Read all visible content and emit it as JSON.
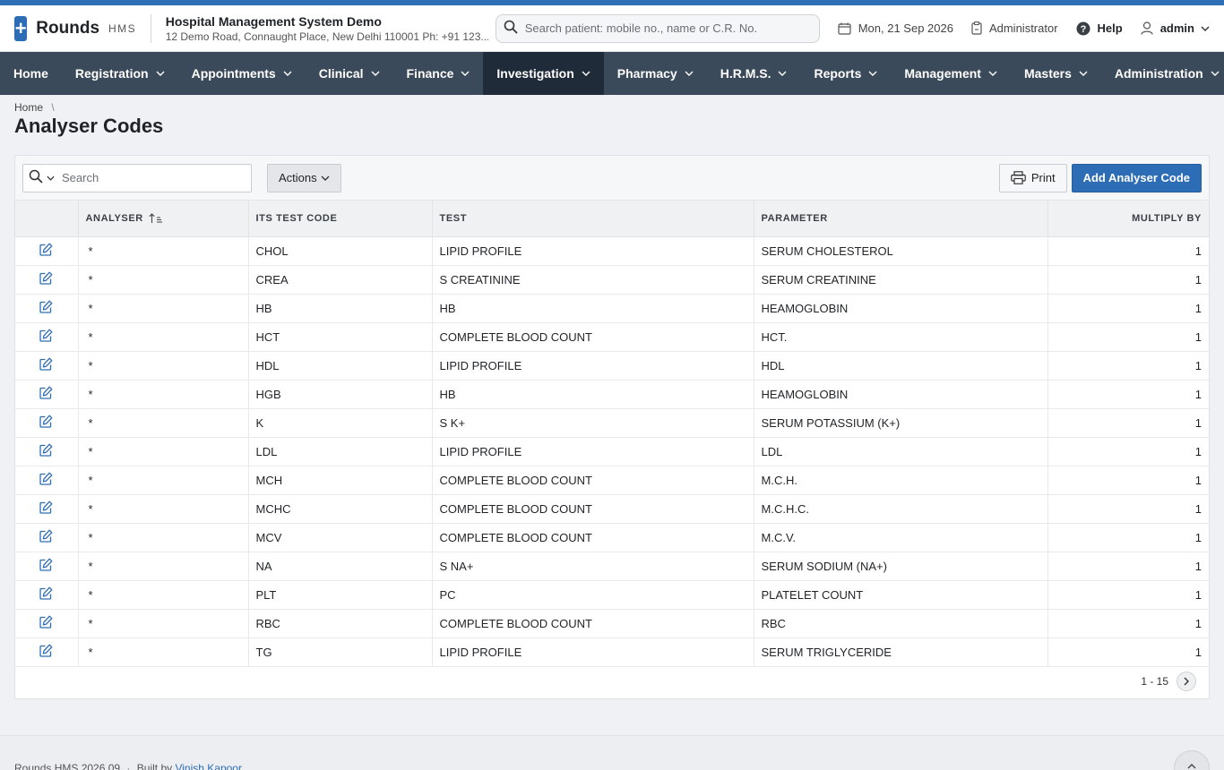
{
  "app": {
    "brand": "Rounds",
    "brand_sub": "HMS",
    "logo_icon": "plus-icon",
    "accent": "#2d6db5",
    "nav_bg": "#3b4a5a"
  },
  "header": {
    "org_name": "Hospital Management System Demo",
    "org_address": "12 Demo Road, Connaught Place, New Delhi 110001 Ph: +91 123...",
    "search_placeholder": "Search patient: mobile no., name or C.R. No.",
    "date": "Mon, 21 Sep 2026",
    "role": "Administrator",
    "help": "Help",
    "user": "admin"
  },
  "nav": {
    "items": [
      {
        "label": "Home"
      },
      {
        "label": "Registration"
      },
      {
        "label": "Appointments"
      },
      {
        "label": "Clinical"
      },
      {
        "label": "Finance"
      },
      {
        "label": "Investigation",
        "active": true
      },
      {
        "label": "Pharmacy"
      },
      {
        "label": "H.R.M.S."
      },
      {
        "label": "Reports"
      },
      {
        "label": "Management"
      },
      {
        "label": "Masters"
      },
      {
        "label": "Administration"
      }
    ]
  },
  "breadcrumb": {
    "home": "Home",
    "separator": "\\"
  },
  "page": {
    "title": "Analyser Codes"
  },
  "toolbar": {
    "search_placeholder": "Search",
    "actions_label": "Actions",
    "print_label": "Print",
    "add_label": "Add Analyser Code"
  },
  "table": {
    "columns": [
      "",
      "ANALYSER",
      "ITS TEST CODE",
      "TEST",
      "PARAMETER",
      "MULTIPLY BY"
    ],
    "sorted_column": "ANALYSER",
    "rows": [
      [
        "*",
        "CHOL",
        "LIPID PROFILE",
        "SERUM CHOLESTEROL",
        "1"
      ],
      [
        "*",
        "CREA",
        "S CREATININE",
        "SERUM CREATININE",
        "1"
      ],
      [
        "*",
        "HB",
        "HB",
        "HEAMOGLOBIN",
        "1"
      ],
      [
        "*",
        "HCT",
        "COMPLETE BLOOD COUNT",
        "HCT.",
        "1"
      ],
      [
        "*",
        "HDL",
        "LIPID PROFILE",
        "HDL",
        "1"
      ],
      [
        "*",
        "HGB",
        "HB",
        "HEAMOGLOBIN",
        "1"
      ],
      [
        "*",
        "K",
        "S K+",
        "SERUM POTASSIUM (K+)",
        "1"
      ],
      [
        "*",
        "LDL",
        "LIPID PROFILE",
        "LDL",
        "1"
      ],
      [
        "*",
        "MCH",
        "COMPLETE BLOOD COUNT",
        "M.C.H.",
        "1"
      ],
      [
        "*",
        "MCHC",
        "COMPLETE BLOOD COUNT",
        "M.C.H.C.",
        "1"
      ],
      [
        "*",
        "MCV",
        "COMPLETE BLOOD COUNT",
        "M.C.V.",
        "1"
      ],
      [
        "*",
        "NA",
        "S NA+",
        "SERUM SODIUM (NA+)",
        "1"
      ],
      [
        "*",
        "PLT",
        "PC",
        "PLATELET COUNT",
        "1"
      ],
      [
        "*",
        "RBC",
        "COMPLETE BLOOD COUNT",
        "RBC",
        "1"
      ],
      [
        "*",
        "TG",
        "LIPID PROFILE",
        "SERUM TRIGLYCERIDE",
        "1"
      ]
    ]
  },
  "pagination": {
    "range": "1 - 15"
  },
  "footer": {
    "version": "Rounds HMS 2026.09",
    "built_by": "Built by",
    "author": "Vinish Kapoor"
  }
}
